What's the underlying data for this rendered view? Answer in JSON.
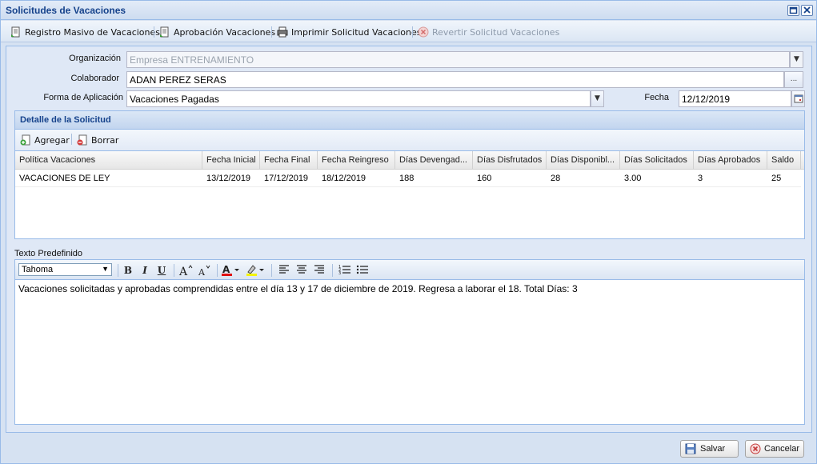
{
  "window": {
    "title": "Solicitudes de Vacaciones"
  },
  "toolbar": {
    "registro_masivo": "Registro Masivo de Vacaciones",
    "aprobacion": "Aprobación Vacaciones",
    "imprimir": "Imprimir Solicitud Vacaciones",
    "revertir": "Revertir Solicitud Vacaciones"
  },
  "form": {
    "organizacion_label": "Organización",
    "organizacion_value": "Empresa ENTRENAMIENTO",
    "colaborador_label": "Colaborador",
    "colaborador_value": "ADAN PEREZ SERAS",
    "colaborador_lookup": "...",
    "forma_label": "Forma de Aplicación",
    "forma_value": "Vacaciones Pagadas",
    "fecha_label": "Fecha",
    "fecha_value": "12/12/2019"
  },
  "detalle": {
    "title": "Detalle de la Solicitud",
    "agregar": "Agregar",
    "borrar": "Borrar",
    "columns": [
      "Política Vacaciones",
      "Fecha Inicial",
      "Fecha Final",
      "Fecha Reingreso",
      "Días Devengad...",
      "Días Disfrutados",
      "Días Disponibl...",
      "Días Solicitados",
      "Días Aprobados",
      "Saldo"
    ],
    "rows": [
      [
        "VACACIONES DE LEY",
        "13/12/2019",
        "17/12/2019",
        "18/12/2019",
        "188",
        "160",
        "28",
        "3.00",
        "3",
        "25"
      ]
    ]
  },
  "texto": {
    "label": "Texto Predefinido",
    "font": "Tahoma",
    "body": "Vacaciones solicitadas y aprobadas comprendidas entre el día 13 y 17 de diciembre de 2019. Regresa a laborar el 18. Total Días: 3",
    "bold": "B",
    "italic": "I",
    "underline": "U"
  },
  "footer": {
    "salvar": "Salvar",
    "cancelar": "Cancelar"
  },
  "colors": {
    "accent": "#15428b",
    "border": "#99bbe8",
    "panel_bg": "#dfe8f6"
  }
}
